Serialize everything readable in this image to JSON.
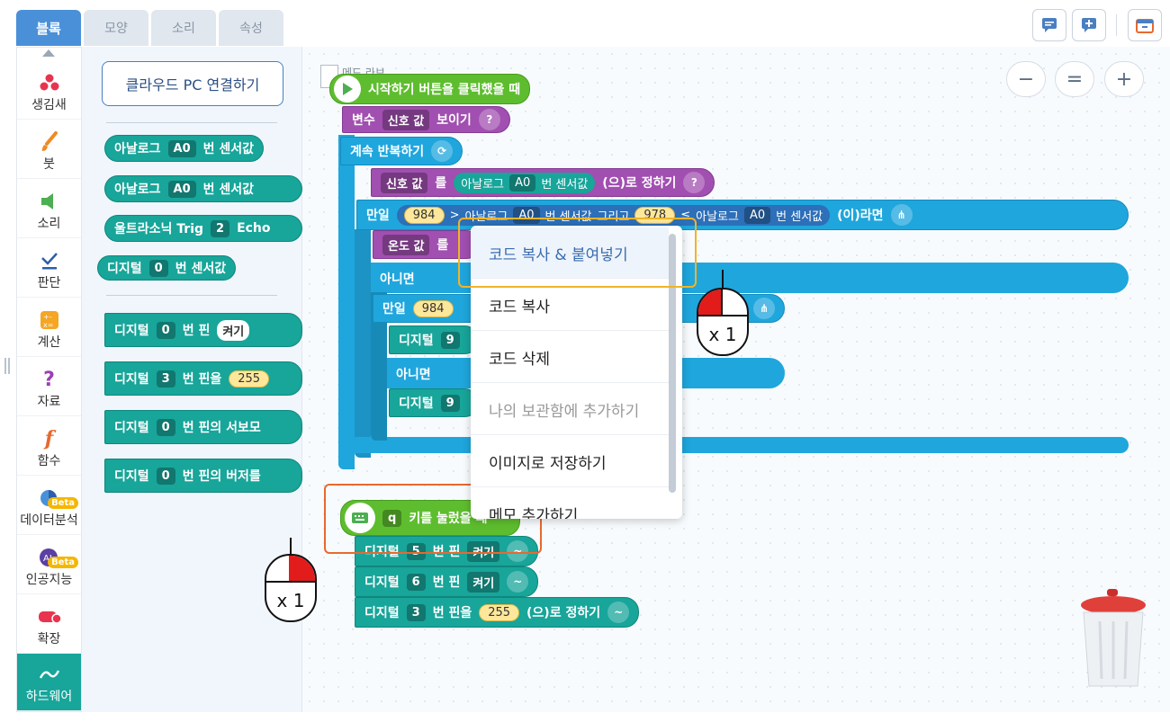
{
  "tabs": [
    {
      "label": "블록",
      "active": true
    },
    {
      "label": "모양"
    },
    {
      "label": "소리"
    },
    {
      "label": "속성"
    }
  ],
  "categories": [
    {
      "label": "생김새",
      "icon": "shapes-icon"
    },
    {
      "label": "붓",
      "icon": "brush-icon"
    },
    {
      "label": "소리",
      "icon": "speaker-icon"
    },
    {
      "label": "판단",
      "icon": "check-icon"
    },
    {
      "label": "계산",
      "icon": "calculator-icon"
    },
    {
      "label": "자료",
      "icon": "question-icon"
    },
    {
      "label": "함수",
      "icon": "function-icon"
    },
    {
      "label": "데이터분석",
      "icon": "pie-icon",
      "badge": "Beta"
    },
    {
      "label": "인공지능",
      "icon": "ai-icon",
      "badge": "Beta"
    },
    {
      "label": "확장",
      "icon": "extension-icon"
    },
    {
      "label": "하드웨어",
      "icon": "hardware-icon",
      "active": true
    }
  ],
  "palette": {
    "cloud_button": "클라우드 PC 연결하기",
    "blocks": [
      {
        "p": [
          "아날로그",
          "A0",
          "번 센서값"
        ]
      },
      {
        "p": [
          "아날로그",
          "A0",
          "번 센서값"
        ]
      },
      {
        "p": [
          "울트라소닉 Trig",
          "2",
          "Echo"
        ]
      },
      {
        "p": [
          "디지털",
          "0",
          "번 센서값"
        ]
      },
      {
        "p": [
          "디지털",
          "0",
          "번 핀",
          "켜기"
        ]
      },
      {
        "p": [
          "디지털",
          "3",
          "번 핀을",
          "255"
        ]
      },
      {
        "p": [
          "디지털",
          "0",
          "번 핀의 서보모"
        ]
      },
      {
        "p": [
          "디지털",
          "0",
          "번 핀의 버저를"
        ]
      }
    ]
  },
  "workspace": {
    "comment_label": "메드 라브",
    "start_block": "시작하기 버튼을 클릭했을 때",
    "show_var": {
      "t1": "변수",
      "dd": "신호 값",
      "t2": "보이기"
    },
    "loop": "계속 반복하기",
    "set_var": {
      "dd": "신호 값",
      "t1": "를",
      "t2": "아날로그",
      "pin": "A0",
      "t3": "번 센서값",
      "t4": "(으)로 정하기"
    },
    "if1": {
      "t1": "만일",
      "n1": "984",
      "op1": ">",
      "t2": "아날로그",
      "pin1": "A0",
      "t3": "번 센서값",
      "and": "그리고",
      "n2": "978",
      "op2": "≤",
      "t4": "아날로그",
      "pin2": "A0",
      "t5": "번 센서값",
      "t6": "(이)라면"
    },
    "set_temp": {
      "dd": "온도 값",
      "t1": "를"
    },
    "else1": "아니면",
    "if2": {
      "t1": "만일",
      "n1": "984"
    },
    "digital_a": {
      "t1": "디지털",
      "n": "9"
    },
    "else2": "아니면",
    "digital_b": {
      "t1": "디지털",
      "n": "9"
    },
    "key_event": {
      "key": "q",
      "text": "키를 눌렀을 때"
    },
    "pins": [
      {
        "t1": "디지털",
        "n": "5",
        "t2": "번 핀",
        "v": "켜기"
      },
      {
        "t1": "디지털",
        "n": "6",
        "t2": "번 핀",
        "v": "켜기"
      },
      {
        "t1": "디지털",
        "n": "3",
        "t2": "번 핀을",
        "v": "255",
        "t3": "(으)로 정하기"
      }
    ]
  },
  "context_menu": [
    {
      "label": "코드 복사 & 붙여넣기",
      "highlighted": true
    },
    {
      "label": "코드 복사"
    },
    {
      "label": "코드 삭제"
    },
    {
      "label": "나의 보관함에 추가하기",
      "disabled": true
    },
    {
      "label": "이미지로 저장하기"
    },
    {
      "label": "메모 추가하기"
    }
  ],
  "zoom": {
    "minus": "−",
    "reset": "=",
    "plus": "+"
  },
  "mouse_indicators": [
    {
      "label": "x 1"
    },
    {
      "label": "x 1"
    }
  ],
  "colors": {
    "accent": "#4a90d9",
    "hardware": "#18a59a",
    "highlight_yellow": "#f0b429",
    "highlight_orange": "#e8692e"
  }
}
